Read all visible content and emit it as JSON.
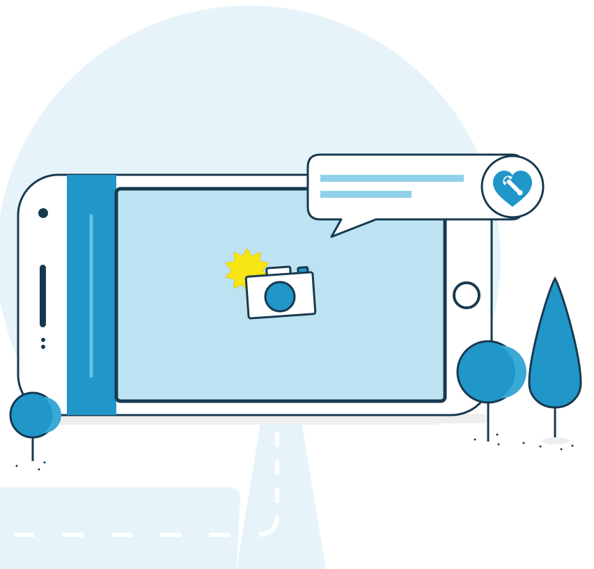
{
  "palette": {
    "background": "#ffffff",
    "backdrop_circle": "#e6f4fa",
    "road": "#e6f4fa",
    "road_dash": "#ffffff",
    "phone_body": "#ffffff",
    "phone_outline": "#17394f",
    "phone_side_band": "#2196c9",
    "phone_side_band_highlight": "#69c1e6",
    "screen": "#bde2f1",
    "bubble_fill": "#ffffff",
    "bubble_lines": "#8fd0ea",
    "heart": "#2196c9",
    "wrench": "#ffffff",
    "camera_body": "#ffffff",
    "camera_lens": "#2196c9",
    "flash_burst": "#f7e614",
    "tree_fill": "#2196c9",
    "tree_highlight": "#39a9d6",
    "ground_shadow": "#eeeeee"
  },
  "icons": {
    "speech_bubble": "speech-bubble-icon",
    "service_badge": "heart-wrench-icon",
    "camera": "camera-icon",
    "flash": "flash-burst-icon",
    "home_button": "home-button-icon",
    "trees": [
      "round-tree-icon",
      "round-tree-icon",
      "cone-tree-icon"
    ]
  }
}
